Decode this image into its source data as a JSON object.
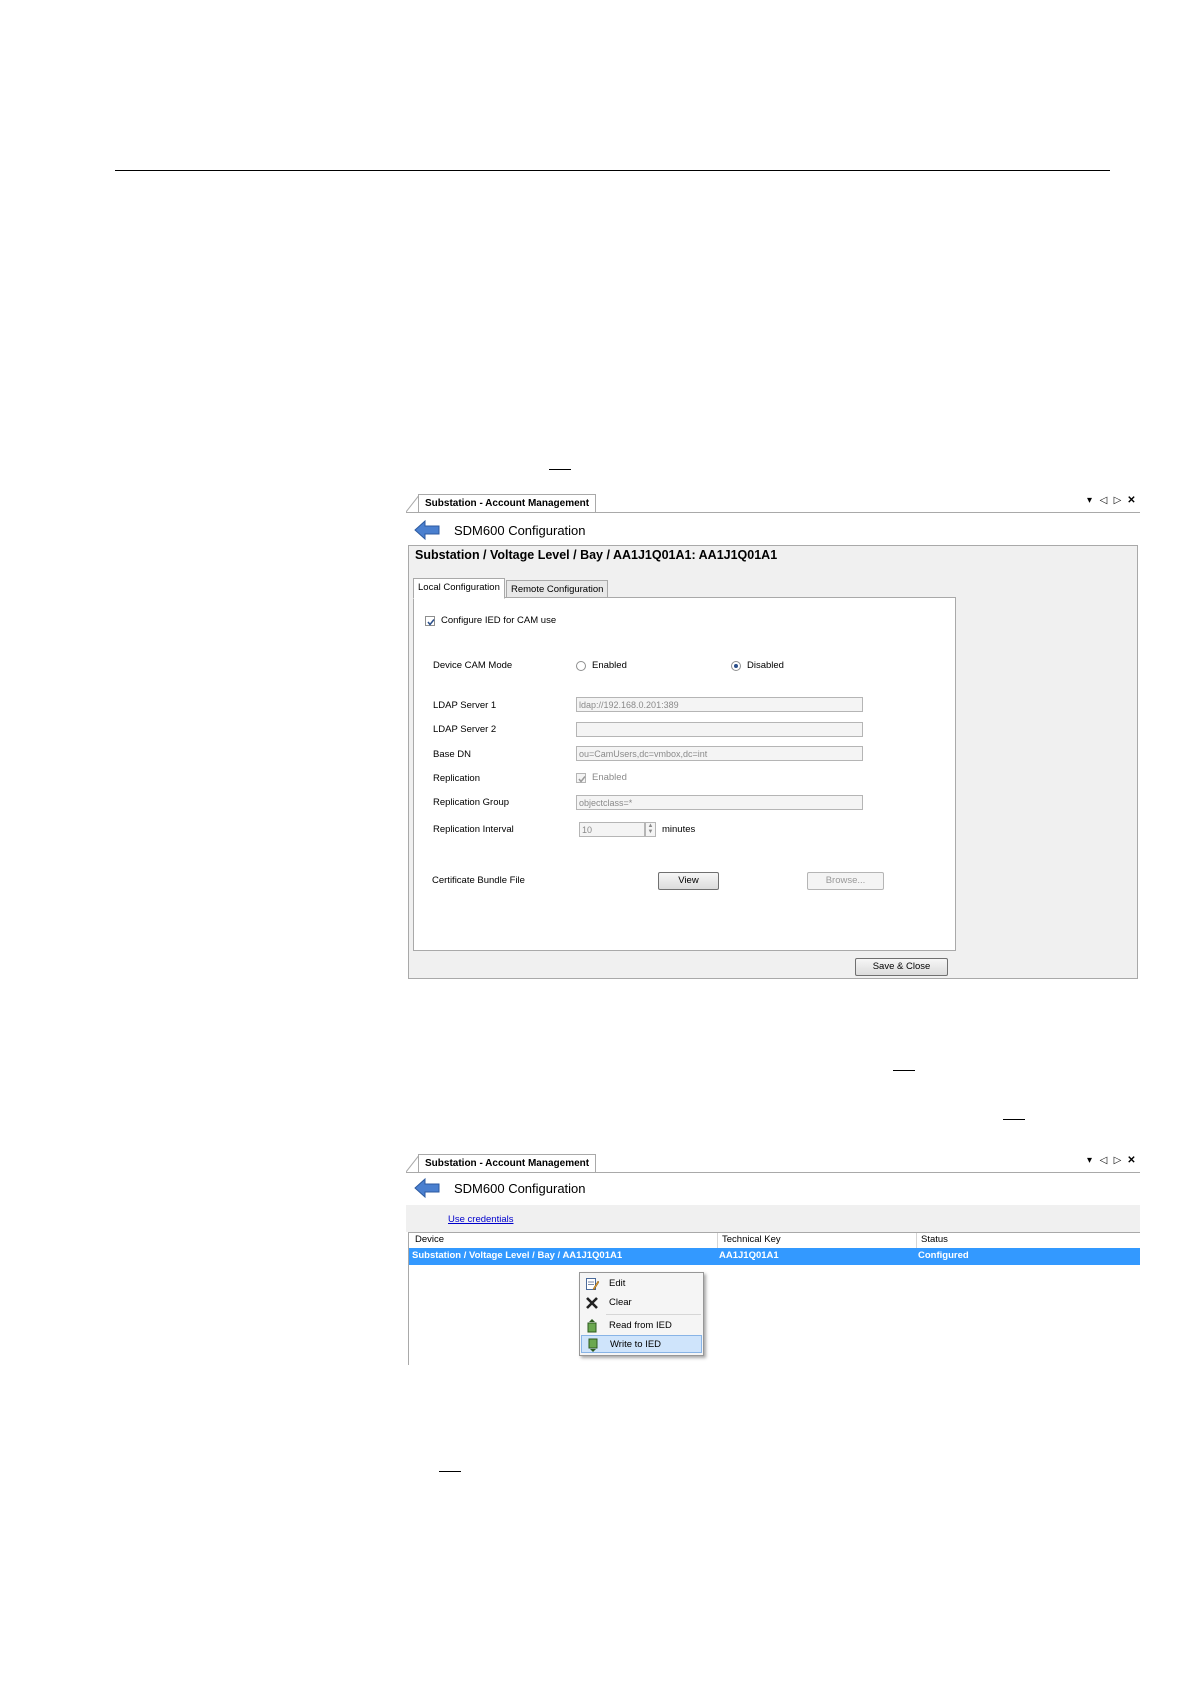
{
  "screen1": {
    "doc_tab": "Substation - Account Management",
    "header_title": "SDM600 Configuration",
    "breadcrumb": "Substation / Voltage Level / Bay / AA1J1Q01A1: AA1J1Q01A1",
    "tabs": [
      "Local Configuration",
      "Remote Configuration"
    ],
    "configure_checkbox": {
      "label": "Configure IED for CAM use",
      "checked": true
    },
    "cam_mode": {
      "label": "Device CAM Mode",
      "option1": "Enabled",
      "option2": "Disabled",
      "selected": "Disabled"
    },
    "ldap1": {
      "label": "LDAP Server 1",
      "value": "ldap://192.168.0.201:389"
    },
    "ldap2": {
      "label": "LDAP Server 2",
      "value": ""
    },
    "base_dn": {
      "label": "Base DN",
      "value": "ou=CamUsers,dc=vmbox,dc=int"
    },
    "replication": {
      "label": "Replication",
      "checkbox_label": "Enabled",
      "checked": true
    },
    "replication_group": {
      "label": "Replication Group",
      "value": "objectclass=*"
    },
    "replication_interval": {
      "label": "Replication Interval",
      "value": "10",
      "unit": "minutes"
    },
    "certificate": {
      "label": "Certificate Bundle File",
      "view_button": "View",
      "browse_button": "Browse..."
    },
    "save_close_button": "Save & Close"
  },
  "screen2": {
    "doc_tab": "Substation - Account Management",
    "header_title": "SDM600 Configuration",
    "credentials_link": "Use credentials",
    "columns": [
      "Device",
      "Technical Key",
      "Status"
    ],
    "row": {
      "device": "Substation / Voltage Level / Bay / AA1J1Q01A1",
      "technical_key": "AA1J1Q01A1",
      "status": "Configured"
    },
    "context_menu": [
      "Edit",
      "Clear",
      "Read from IED",
      "Write to IED"
    ]
  },
  "colors": {
    "selection": "#3399ff",
    "menu_highlight": "#cfe4fb",
    "link": "#0000cc"
  }
}
